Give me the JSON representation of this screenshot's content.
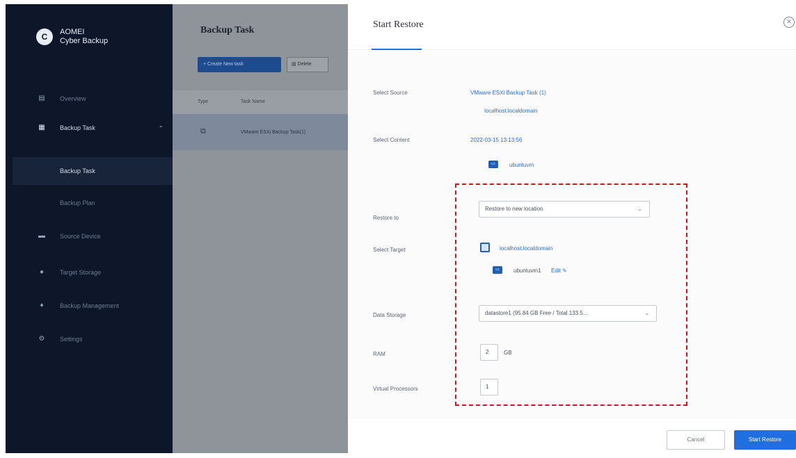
{
  "app": {
    "brand_line1": "AOMEI",
    "brand_line2": "Cyber Backup",
    "logo_letter": "C"
  },
  "sidebar": {
    "items": [
      {
        "label": "Overview",
        "icon": "overview-icon",
        "glyph": "▤"
      },
      {
        "label": "Backup Task",
        "icon": "backup-task-icon",
        "glyph": "▦",
        "caret": "⌃"
      },
      {
        "label": "Backup Task"
      },
      {
        "label": "Backup Plan"
      },
      {
        "label": "Source Device",
        "icon": "monitor-icon",
        "glyph": "▬"
      },
      {
        "label": "Target Storage",
        "icon": "location-icon",
        "glyph": "●"
      },
      {
        "label": "Backup Management",
        "icon": "shield-icon",
        "glyph": "♦"
      },
      {
        "label": "Settings",
        "icon": "settings-icon",
        "glyph": "⚙"
      }
    ]
  },
  "task_panel": {
    "title": "Backup Task",
    "create_label": "+ Create New task",
    "delete_label": "▤ Delete",
    "col_type": "Type",
    "col_name": "Task Name",
    "row_name": "VMware ESXi Backup Task(1)"
  },
  "restore": {
    "title": "Start Restore",
    "close_glyph": "✕",
    "source": {
      "label": "Select Source",
      "task": "VMware ESXi Backup Task (1)",
      "host": "localhost.localdomain"
    },
    "content": {
      "label": "Select Content",
      "timestamp": "2022-03-15 13:13:56",
      "vm": "ubuntuvm"
    },
    "restore_to": {
      "label": "Restore to",
      "value": "Restore to new location"
    },
    "target": {
      "label": "Select Target",
      "host": "localhost.localdomain",
      "vm": "ubuntuvm1",
      "edit_label": "Edit ✎"
    },
    "storage": {
      "label": "Data Storage",
      "value": "datastore1 (95.84 GB Free / Total 133.5..."
    },
    "ram": {
      "label": "RAM",
      "value": "2",
      "unit": "GB"
    },
    "vcpu": {
      "label": "Virtual Processors",
      "value": "1"
    },
    "cancel_label": "Cancel",
    "start_label": "Start Restore"
  },
  "colors": {
    "sidebar_bg": "#0d1729",
    "accent": "#1f6fe0",
    "highlight_border": "#d8101a"
  }
}
